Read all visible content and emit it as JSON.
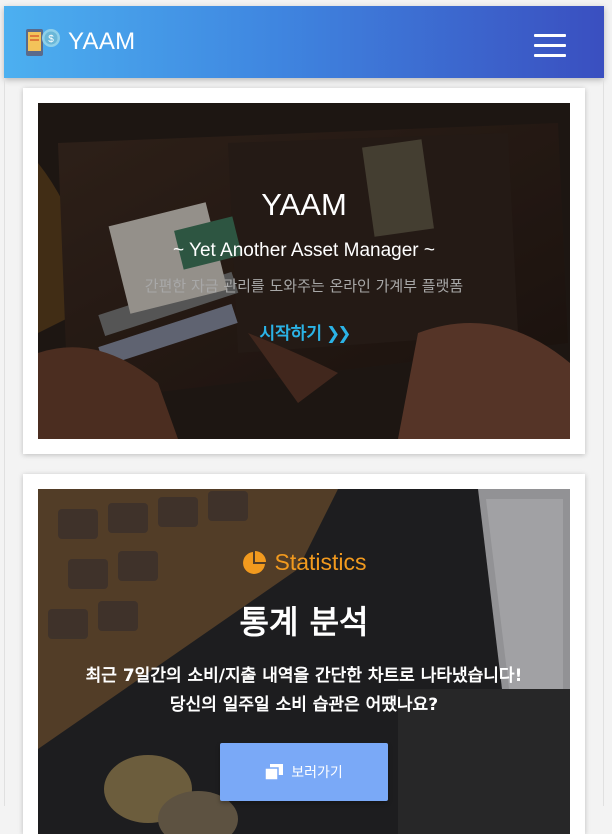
{
  "header": {
    "brand_name": "YAAM",
    "logo_icon": "phone-money-icon",
    "menu_icon": "hamburger-menu-icon",
    "gradient": [
      "#4cb0f0",
      "#3a4fc0"
    ]
  },
  "hero": {
    "title": "YAAM",
    "subtitle": "~ Yet Another Asset Manager ~",
    "description": "간편한 자금 관리를 도와주는 온라인 가계부 플랫폼",
    "cta_label": "시작하기",
    "cta_icon": "double-chevron-right-icon",
    "cta_color": "#2bb3e6"
  },
  "stats": {
    "label": "Statistics",
    "label_icon": "pie-chart-icon",
    "label_color": "#f29a1e",
    "title": "통계 분석",
    "line1": "최근 7일간의 소비/지출 내역을 간단한 차트로 나타냈습니다!",
    "line2": "당신의 일주일 소비 습관은 어땠나요?",
    "button_label": "보러가기",
    "button_icon": "copy-icon",
    "button_color": "#7aa9f7"
  }
}
